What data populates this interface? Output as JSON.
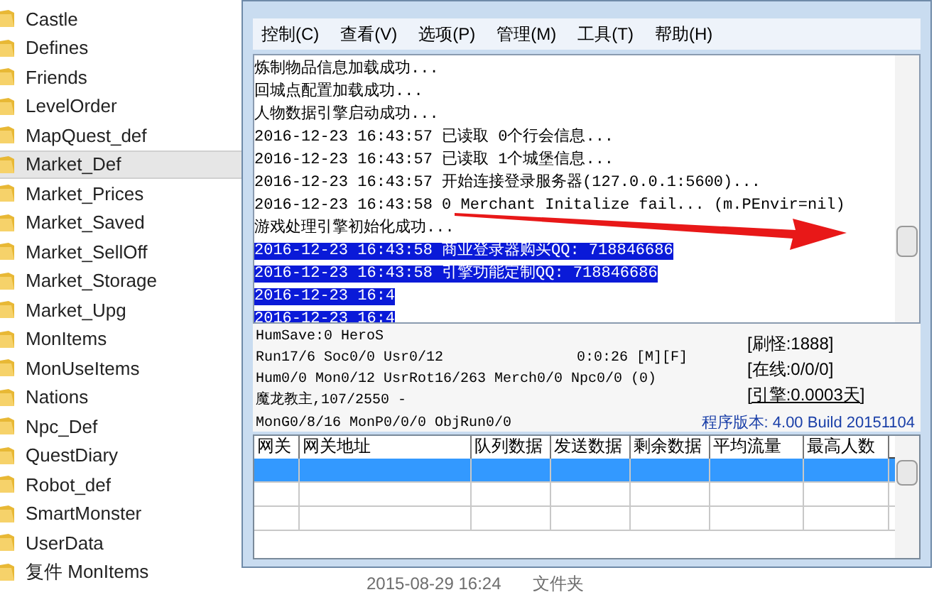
{
  "file_list": {
    "items": [
      {
        "name": "Castle",
        "selected": false
      },
      {
        "name": "Defines",
        "selected": false
      },
      {
        "name": "Friends",
        "selected": false
      },
      {
        "name": "LevelOrder",
        "selected": false
      },
      {
        "name": "MapQuest_def",
        "selected": false
      },
      {
        "name": "Market_Def",
        "selected": true
      },
      {
        "name": "Market_Prices",
        "selected": false
      },
      {
        "name": "Market_Saved",
        "selected": false
      },
      {
        "name": "Market_SellOff",
        "selected": false
      },
      {
        "name": "Market_Storage",
        "selected": false
      },
      {
        "name": "Market_Upg",
        "selected": false
      },
      {
        "name": "MonItems",
        "selected": false
      },
      {
        "name": "MonUseItems",
        "selected": false
      },
      {
        "name": "Nations",
        "selected": false
      },
      {
        "name": "Npc_Def",
        "selected": false
      },
      {
        "name": "QuestDiary",
        "selected": false
      },
      {
        "name": "Robot_def",
        "selected": false
      },
      {
        "name": "SmartMonster",
        "selected": false
      },
      {
        "name": "UserData",
        "selected": false
      },
      {
        "name": "复件 MonItems",
        "selected": false
      }
    ],
    "modified": "2015-08-29 16:24",
    "type": "文件夹"
  },
  "window": {
    "menu": [
      "控制(C)",
      "查看(V)",
      "选项(P)",
      "管理(M)",
      "工具(T)",
      "帮助(H)"
    ],
    "log": [
      {
        "text": "炼制物品信息加载成功...",
        "selected": false
      },
      {
        "text": "回城点配置加载成功...",
        "selected": false
      },
      {
        "text": "人物数据引擎启动成功...",
        "selected": false
      },
      {
        "text": "2016-12-23 16:43:57 已读取 0个行会信息...",
        "selected": false
      },
      {
        "text": "2016-12-23 16:43:57 已读取 1个城堡信息...",
        "selected": false
      },
      {
        "text": "2016-12-23 16:43:57 开始连接登录服务器(127.0.0.1:5600)...",
        "selected": false
      },
      {
        "text": "2016-12-23 16:43:58 0 Merchant Initalize fail... (m.PEnvir=nil)",
        "selected": false
      },
      {
        "text": "游戏处理引擎初始化成功...",
        "selected": false
      },
      {
        "text": "2016-12-23 16:43:58 商业登录器购买QQ: 718846686",
        "selected": true
      },
      {
        "text": "2016-12-23 16:43:58 引擎功能定制QQ: 718846686",
        "selected": true
      },
      {
        "text": "2016-12-23 16:4",
        "selected": true
      },
      {
        "text": "2016-12-23 16:4",
        "selected": true
      }
    ],
    "status_lines": [
      "HumSave:0 HeroS",
      "Run17/6 Soc0/0 Usr0/12",
      "Hum0/0 Mon0/12 UsrRot16/263 Merch0/0 Npc0/0 (0)",
      "魔龙教主,107/2550 -",
      "MonG0/8/16 MonP0/0/0 ObjRun0/0"
    ],
    "timer": "0:0:26 [M][F]",
    "counters": [
      "[刷怪:1888]",
      "[在线:0/0/0]",
      "[引擎:0.0003天]"
    ],
    "version": "程序版本: 4.00 Build 20151104",
    "table": {
      "columns": [
        "网关",
        "网关地址",
        "队列数据",
        "发送数据",
        "剩余数据",
        "平均流量",
        "最高人数"
      ],
      "rows": [
        {
          "selected": true
        },
        {
          "selected": false
        },
        {
          "selected": false
        }
      ]
    }
  }
}
